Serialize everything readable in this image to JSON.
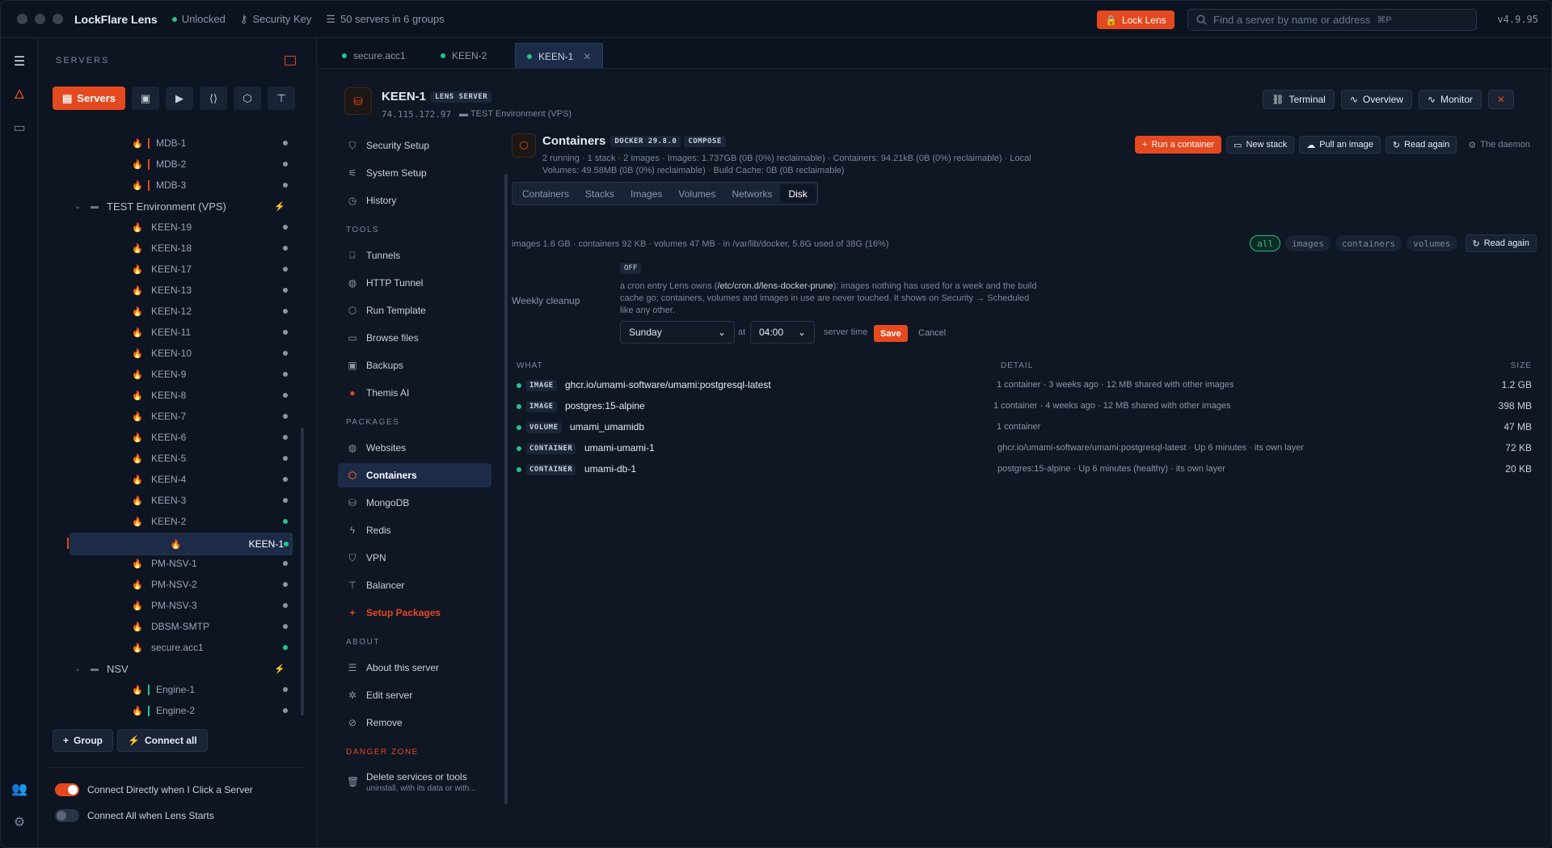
{
  "titlebar": {
    "app_name": "LockFlare Lens",
    "lock_state": "Unlocked",
    "key_label": "Security Key",
    "servers_summary": "50 servers in 6 groups",
    "lock_button": "Lock Lens",
    "search_placeholder": "Find a server by name or address",
    "search_shortcut": "⌘P",
    "version": "v4.9.95"
  },
  "sidebar": {
    "heading": "SERVERS",
    "tabs": [
      {
        "label": "Servers",
        "icon": "server-icon"
      },
      {
        "icon": "terminal-icon"
      },
      {
        "icon": "play-icon"
      },
      {
        "icon": "code-icon"
      },
      {
        "icon": "package-icon"
      },
      {
        "icon": "network-icon"
      }
    ],
    "tree": [
      {
        "label": "MDB-1",
        "status": "gray",
        "bar": "#e4491f"
      },
      {
        "label": "MDB-2",
        "status": "gray",
        "bar": "#e4491f"
      },
      {
        "label": "MDB-3",
        "status": "gray",
        "bar": "#e4491f"
      },
      {
        "label": "TEST Environment (VPS)",
        "group": true
      },
      {
        "label": "KEEN-19",
        "status": "gray"
      },
      {
        "label": "KEEN-18",
        "status": "gray"
      },
      {
        "label": "KEEN-17",
        "status": "gray"
      },
      {
        "label": "KEEN-13",
        "status": "gray"
      },
      {
        "label": "KEEN-12",
        "status": "gray"
      },
      {
        "label": "KEEN-11",
        "status": "gray"
      },
      {
        "label": "KEEN-10",
        "status": "gray"
      },
      {
        "label": "KEEN-9",
        "status": "gray"
      },
      {
        "label": "KEEN-8",
        "status": "gray"
      },
      {
        "label": "KEEN-7",
        "status": "gray"
      },
      {
        "label": "KEEN-6",
        "status": "gray"
      },
      {
        "label": "KEEN-5",
        "status": "gray"
      },
      {
        "label": "KEEN-4",
        "status": "gray"
      },
      {
        "label": "KEEN-3",
        "status": "gray"
      },
      {
        "label": "KEEN-2",
        "status": "green"
      },
      {
        "label": "KEEN-1",
        "status": "green",
        "selected": true
      },
      {
        "label": "PM-NSV-1",
        "status": "gray"
      },
      {
        "label": "PM-NSV-2",
        "status": "gray"
      },
      {
        "label": "PM-NSV-3",
        "status": "gray"
      },
      {
        "label": "DBSM-SMTP",
        "status": "gray"
      },
      {
        "label": "secure.acc1",
        "status": "green"
      },
      {
        "label": "NSV",
        "group": true
      },
      {
        "label": "Engine-1",
        "status": "gray",
        "bar": "#22c58b"
      },
      {
        "label": "Engine-2",
        "status": "gray",
        "bar": "#22c58b"
      }
    ],
    "group_button": "Group",
    "connect_all_button": "Connect all",
    "toggle_direct": {
      "label": "Connect Directly when I Click a Server",
      "on": true
    },
    "toggle_start": {
      "label": "Connect All when Lens Starts",
      "on": false
    }
  },
  "tabs": [
    {
      "label": "secure.acc1"
    },
    {
      "label": "KEEN-2"
    },
    {
      "label": "KEEN-1",
      "active": true
    }
  ],
  "header": {
    "title": "KEEN-1",
    "badge": "LENS SERVER",
    "ip": "74.115.172.97",
    "group": "TEST Environment (VPS)",
    "buttons": [
      "Terminal",
      "Overview",
      "Monitor"
    ]
  },
  "nav": {
    "top": [
      "Security Setup",
      "System Setup",
      "History"
    ],
    "tools_heading": "TOOLS",
    "tools": [
      "Tunnels",
      "HTTP Tunnel",
      "Run Template",
      "Browse files",
      "Backups",
      "Themis AI"
    ],
    "packages_heading": "PACKAGES",
    "packages": [
      "Websites",
      "Containers",
      "MongoDB",
      "Redis",
      "VPN",
      "Balancer",
      "Setup Packages"
    ],
    "about_heading": "ABOUT",
    "about": [
      "About this server",
      "Edit server",
      "Remove"
    ],
    "danger_heading": "DANGER ZONE",
    "danger_item": "Delete services or tools",
    "danger_sub": "uninstall, with its data or with..."
  },
  "panel": {
    "title": "Containers",
    "badge1": "DOCKER 29.8.0",
    "badge2": "COMPOSE",
    "meta": "2 running · 1 stack · 2 images · Images: 1.737GB (0B (0%) reclaimable) · Containers: 94.21kB (0B (0%) reclaimable) · Local Volumes: 49.58MB (0B (0%) reclaimable) · Build Cache: 0B (0B reclaimable)",
    "buttons": {
      "run": "Run a container",
      "stack": "New stack",
      "pull": "Pull an image",
      "read": "Read again",
      "daemon": "The daemon"
    },
    "subtabs": [
      "Containers",
      "Stacks",
      "Images",
      "Volumes",
      "Networks",
      "Disk"
    ],
    "disk_summary": "images 1.6 GB · containers 92 KB · volumes 47 MB · in /var/lib/docker, 5.8G used of 38G (16%)",
    "filters": [
      "all",
      "images",
      "containers",
      "volumes"
    ],
    "read_again": "Read again",
    "cleanup": {
      "label": "Weekly cleanup",
      "state": "OFF",
      "desc_pre": "a cron entry Lens owns (",
      "desc_path": "/etc/cron.d/lens-docker-prune",
      "desc_post": "): images nothing has used for a week and the build cache go; containers, volumes and images in use are never touched. It shows on Security → Scheduled like any other.",
      "day": "Sunday",
      "at": "at",
      "time": "04:00",
      "server_time": "server time",
      "save": "Save",
      "cancel": "Cancel"
    },
    "table": {
      "headers": {
        "what": "WHAT",
        "detail": "DETAIL",
        "size": "SIZE"
      },
      "rows": [
        {
          "type": "IMAGE",
          "name": "ghcr.io/umami-software/umami:postgresql-latest",
          "detail": "1 container · 3 weeks ago · 12 MB shared with other images",
          "size": "1.2 GB"
        },
        {
          "type": "IMAGE",
          "name": "postgres:15-alpine",
          "detail": "1 container · 4 weeks ago · 12 MB shared with other images",
          "size": "398 MB"
        },
        {
          "type": "VOLUME",
          "name": "umami_umamidb",
          "detail": "1 container",
          "size": "47 MB"
        },
        {
          "type": "CONTAINER",
          "name": "umami-umami-1",
          "detail": "ghcr.io/umami-software/umami:postgresql-latest · Up 6 minutes · its own layer",
          "size": "72 KB"
        },
        {
          "type": "CONTAINER",
          "name": "umami-db-1",
          "detail": "postgres:15-alpine · Up 6 minutes (healthy) · its own layer",
          "size": "20 KB"
        }
      ]
    }
  }
}
